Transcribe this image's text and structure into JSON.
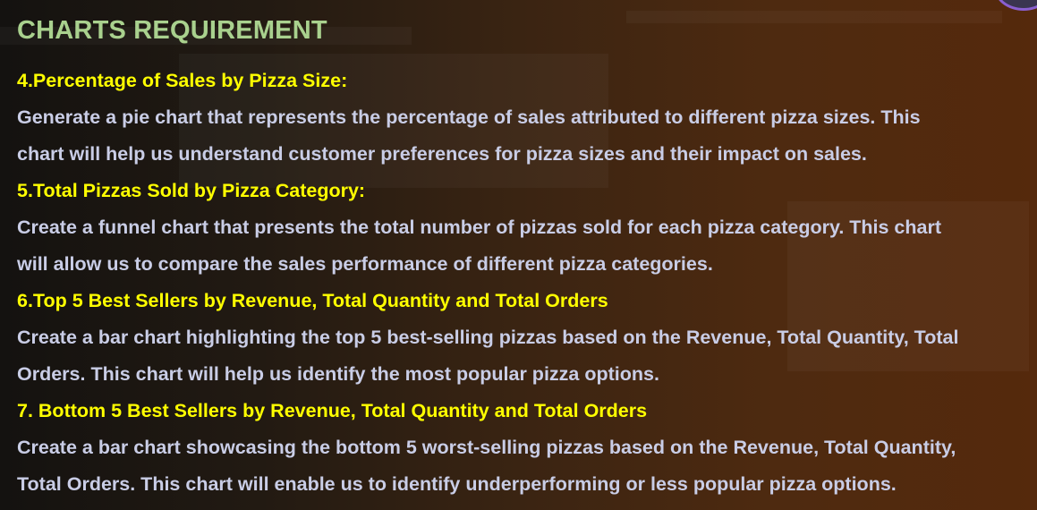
{
  "slide": {
    "title": "CHARTS REQUIREMENT",
    "sections": [
      {
        "heading": "4.Percentage of Sales by Pizza Size:",
        "lines": [
          "Generate a pie chart that represents the percentage of sales attributed to different pizza sizes. This",
          "chart will help us understand customer preferences for pizza sizes and their impact on sales."
        ]
      },
      {
        "heading": "5.Total Pizzas Sold by Pizza Category:",
        "lines": [
          "Create a funnel chart that presents the total number of pizzas sold for each pizza category. This chart",
          "will allow us to compare the sales performance of different pizza categories."
        ]
      },
      {
        "heading": "6.Top 5 Best Sellers by Revenue, Total Quantity and Total Orders",
        "lines": [
          "Create a bar chart highlighting the top 5 best-selling pizzas based on the Revenue, Total Quantity, Total",
          "Orders. This chart will help us identify the most popular pizza options."
        ]
      },
      {
        "heading": "7. Bottom 5 Best Sellers by Revenue, Total Quantity and Total Orders",
        "lines": [
          "Create a bar chart showcasing the bottom 5 worst-selling pizzas based on the Revenue, Total Quantity,",
          "Total Orders. This chart will enable us to identify underperforming or less popular pizza options."
        ]
      }
    ]
  },
  "colors": {
    "title": "#a9d18e",
    "heading": "#ffff00",
    "body": "#c9cde6"
  }
}
